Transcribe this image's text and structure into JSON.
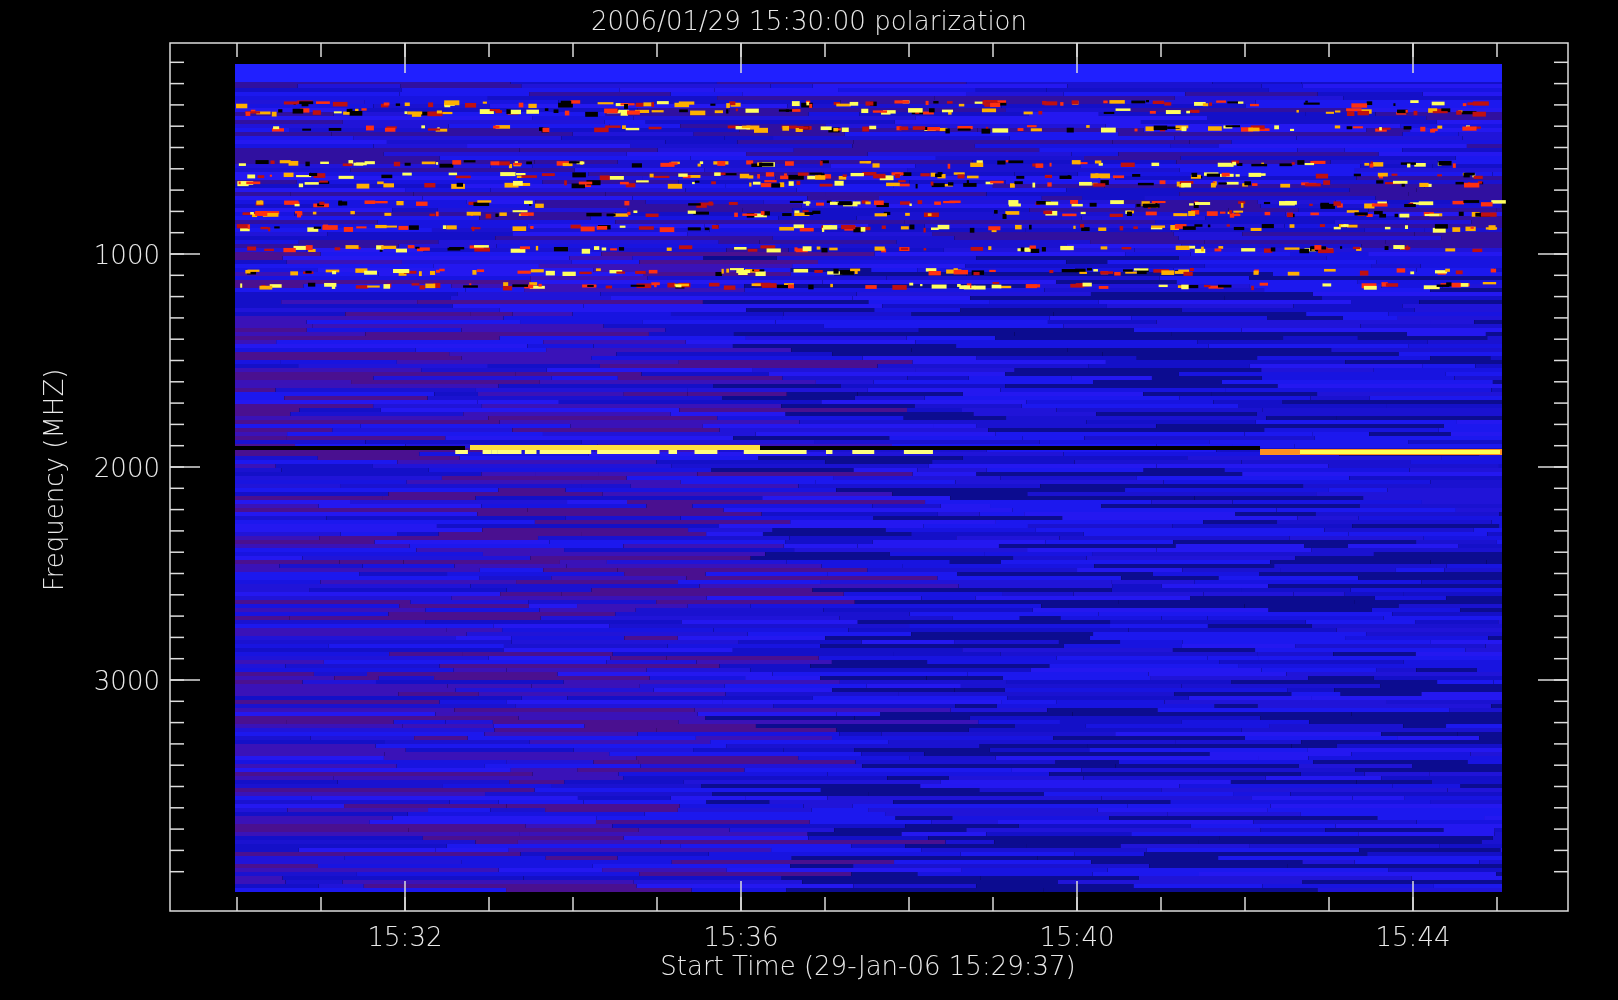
{
  "plot": {
    "title": "2006/01/29 15:30:00 polarization",
    "x_axis": {
      "label": "Start Time (29-Jan-06 15:29:37)",
      "tick_labels": [
        "15:32",
        "15:36",
        "15:40",
        "15:44"
      ]
    },
    "y_axis": {
      "label": "Frequency (MHZ)",
      "tick_labels": [
        "1000",
        "2000",
        "3000"
      ]
    }
  }
}
